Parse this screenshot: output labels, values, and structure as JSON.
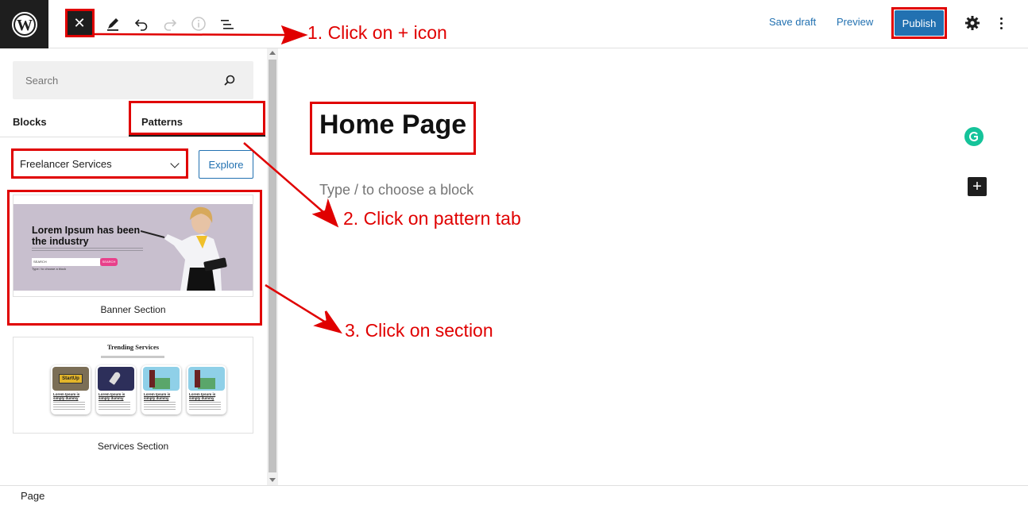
{
  "toolbar": {
    "close_symbol": "✕",
    "save_draft_label": "Save draft",
    "preview_label": "Preview",
    "publish_label": "Publish",
    "icons": [
      "wordpress-logo",
      "close-icon",
      "pencil-icon",
      "undo-icon",
      "redo-icon",
      "info-icon",
      "list-view-icon",
      "gear-icon",
      "kebab-icon"
    ]
  },
  "sidebar": {
    "search_placeholder": "Search",
    "tabs": [
      {
        "label": "Blocks"
      },
      {
        "label": "Patterns"
      }
    ],
    "category_selected": "Freelancer Services",
    "explore_label": "Explore",
    "patterns": [
      {
        "label": "Banner Section",
        "preview": {
          "title": "Lorem Ipsum has been the industry",
          "search_placeholder": "SEARCH",
          "button": "SEARCH",
          "hint": "Type / to choose a block"
        }
      },
      {
        "label": "Services Section",
        "preview": {
          "title": "Trending Services",
          "card_title": "Lorem Ipsum is simply dummy",
          "startup_text": "StartUp"
        }
      }
    ]
  },
  "editor": {
    "page_title": "Home Page",
    "block_hint": "Type / to choose a block"
  },
  "annotations": {
    "step1": "1. Click on + icon",
    "step2": "2. Click on pattern tab",
    "step3": "3. Click on section",
    "color": "#e00000"
  },
  "footer": {
    "breadcrumb": "Page"
  },
  "colors": {
    "accent": "#2271b1",
    "dark": "#1e1e1e",
    "highlight": "#e00000"
  }
}
